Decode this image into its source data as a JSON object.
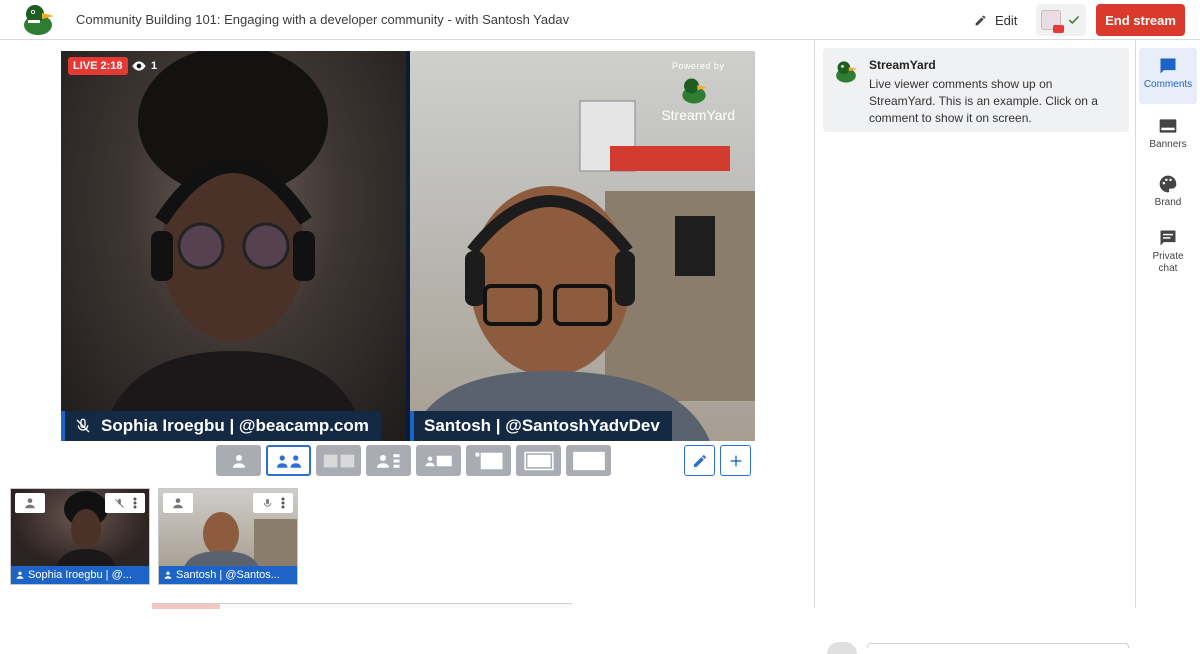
{
  "header": {
    "title": "Community Building 101: Engaging with a developer community - with Santosh Yadav",
    "edit_label": "Edit",
    "end_stream_label": "End stream"
  },
  "stage": {
    "live_label": "LIVE 2:18",
    "viewer_count": "1",
    "powered_by": "Powered by",
    "brand_name": "StreamYard",
    "left_name": "Sophia Iroegbu | @beacamp.com",
    "right_name": "Santosh | @SantoshYadvDev"
  },
  "thumbnails": [
    {
      "label": "Sophia Iroegbu | @..."
    },
    {
      "label": "Santosh | @Santos..."
    }
  ],
  "comments": [
    {
      "author": "StreamYard",
      "text": "Live viewer comments show up on StreamYard. This is an example. Click on a comment to show it on screen."
    }
  ],
  "sidebar": {
    "items": [
      {
        "label": "Comments",
        "icon": "comment-icon"
      },
      {
        "label": "Banners",
        "icon": "banner-icon"
      },
      {
        "label": "Brand",
        "icon": "palette-icon"
      },
      {
        "label": "Private chat",
        "icon": "chat-icon"
      }
    ]
  },
  "colors": {
    "accent": "#1e63c6",
    "end_stream": "#d93a2b",
    "live": "#e53935",
    "name_tag": "#142944"
  }
}
